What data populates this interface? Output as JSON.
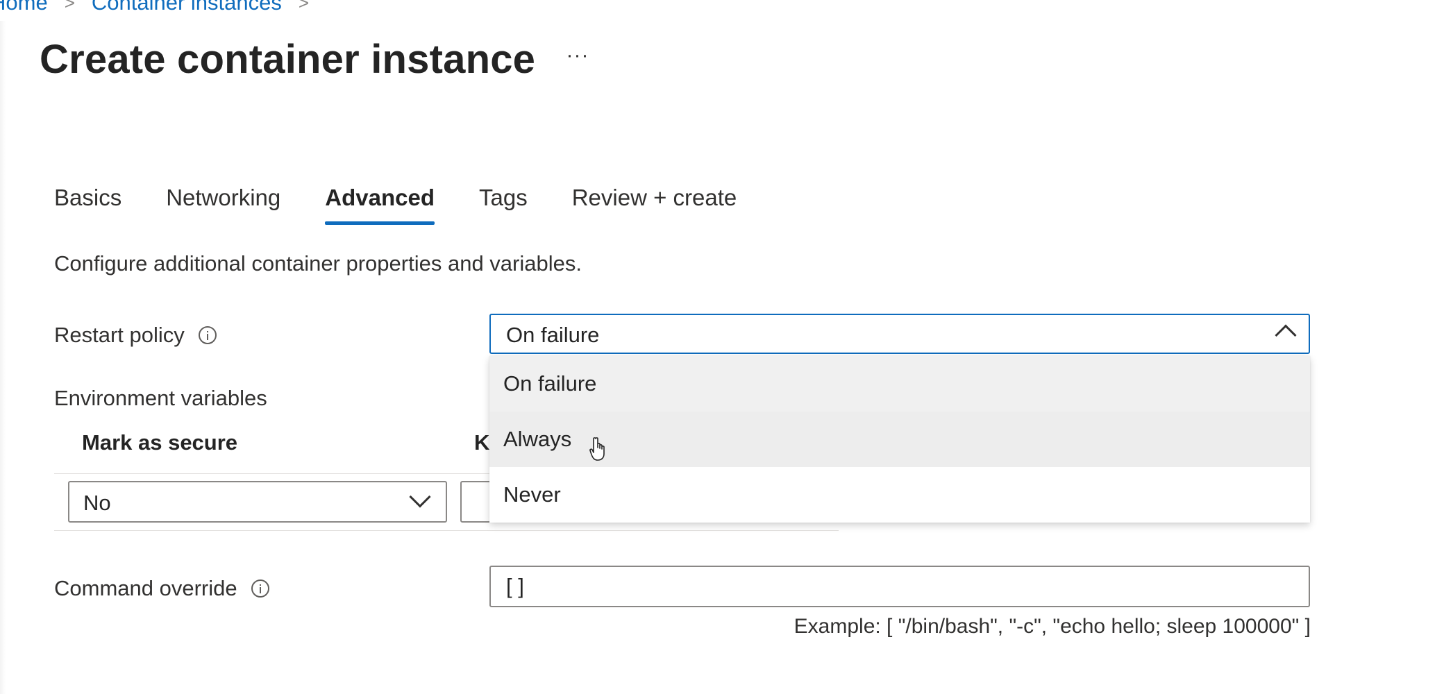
{
  "breadcrumb": {
    "home": "Home",
    "container_instances": "Container instances",
    "separator": ">"
  },
  "page": {
    "title": "Create container instance",
    "more_label": "···"
  },
  "tabs": [
    {
      "label": "Basics",
      "active": false
    },
    {
      "label": "Networking",
      "active": false
    },
    {
      "label": "Advanced",
      "active": true
    },
    {
      "label": "Tags",
      "active": false
    },
    {
      "label": "Review + create",
      "active": false
    }
  ],
  "description": "Configure additional container properties and variables.",
  "restart_policy": {
    "label": "Restart policy",
    "value": "On failure",
    "options": [
      "On failure",
      "Always",
      "Never"
    ],
    "selected_index": 0,
    "hovered_index": 1
  },
  "environment_variables": {
    "label": "Environment variables",
    "columns": {
      "mark_as_secure": "Mark as secure",
      "key": "Key"
    },
    "rows": [
      {
        "mark_as_secure": "No",
        "key": "",
        "value": ""
      }
    ]
  },
  "command_override": {
    "label": "Command override",
    "value": "[ ]",
    "example": "Example: [ \"/bin/bash\", \"-c\", \"echo hello; sleep 100000\" ]"
  },
  "icons": {
    "info": "info-icon",
    "chevron_up": "chevron-up-icon",
    "chevron_down": "chevron-down-icon",
    "cursor": "hand-pointer-icon"
  },
  "colors": {
    "accent": "#0f6cbd",
    "text": "#323130",
    "selected_bg": "#f0f0f0",
    "hover_bg": "#ededed"
  }
}
